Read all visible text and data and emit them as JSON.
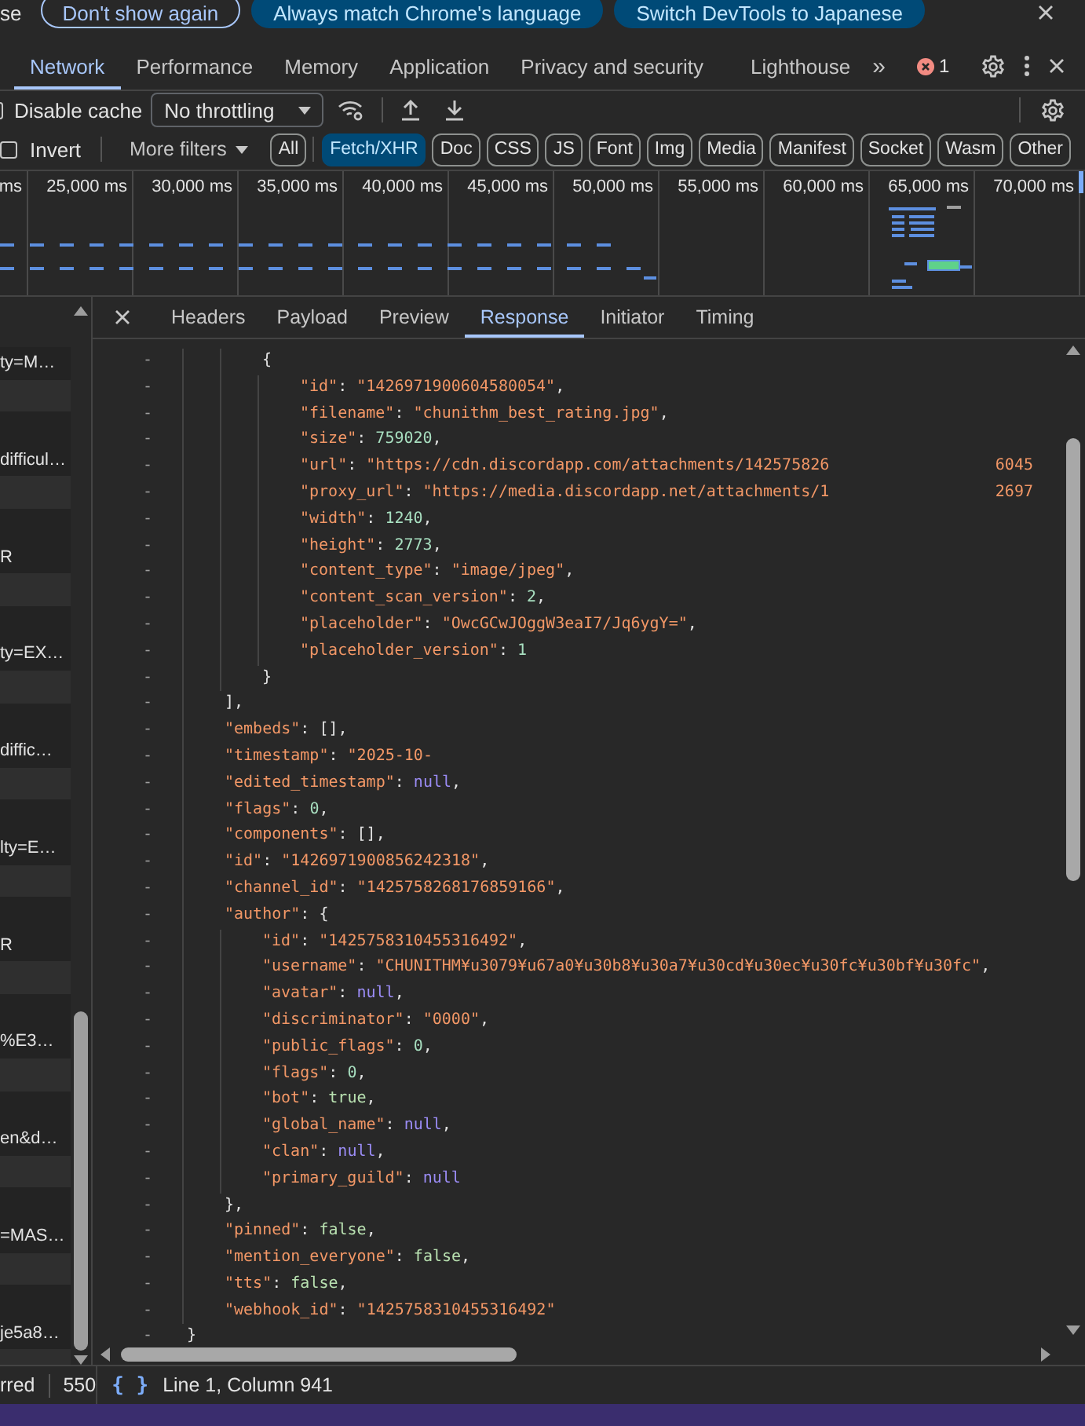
{
  "infobar": {
    "lead_text": "se",
    "buttons": [
      {
        "label": "Don't show again",
        "kind": "outline"
      },
      {
        "label": "Always match Chrome's language",
        "kind": "filled"
      },
      {
        "label": "Switch DevTools to Japanese",
        "kind": "filled"
      }
    ]
  },
  "main_tabs": {
    "items": [
      {
        "label": "Network",
        "selected": true
      },
      {
        "label": "Performance",
        "selected": false
      },
      {
        "label": "Memory",
        "selected": false
      },
      {
        "label": "Application",
        "selected": false
      },
      {
        "label": "Privacy and security",
        "selected": false
      },
      {
        "label": "Lighthouse",
        "selected": false
      }
    ],
    "overflow": "»",
    "error_count": "1"
  },
  "toolbar": {
    "disable_cache": {
      "label": "Disable cache",
      "checked": false
    },
    "throttling": {
      "value": "No throttling"
    }
  },
  "filters": {
    "invert": {
      "label": "Invert",
      "checked": false
    },
    "more_filters": "More filters",
    "chips": [
      {
        "label": "All",
        "selected": false
      },
      {
        "label": "Fetch/XHR",
        "selected": true
      },
      {
        "label": "Doc",
        "selected": false
      },
      {
        "label": "CSS",
        "selected": false
      },
      {
        "label": "JS",
        "selected": false
      },
      {
        "label": "Font",
        "selected": false
      },
      {
        "label": "Img",
        "selected": false
      },
      {
        "label": "Media",
        "selected": false
      },
      {
        "label": "Manifest",
        "selected": false
      },
      {
        "label": "Socket",
        "selected": false
      },
      {
        "label": "Wasm",
        "selected": false
      },
      {
        "label": "Other",
        "selected": false
      }
    ]
  },
  "overview": {
    "ticks": [
      "ms",
      "25,000 ms",
      "30,000 ms",
      "35,000 ms",
      "40,000 ms",
      "45,000 ms",
      "50,000 ms",
      "55,000 ms",
      "60,000 ms",
      "65,000 ms",
      "70,000 ms"
    ]
  },
  "requests": [
    {
      "name": "ty=M…"
    },
    {
      "name": "difficul…"
    },
    {
      "name": "R"
    },
    {
      "name": "ty=EX…"
    },
    {
      "name": "diffic…"
    },
    {
      "name": "lty=E…"
    },
    {
      "name": "R"
    },
    {
      "name": "%E3…"
    },
    {
      "name": "en&d…"
    },
    {
      "name": "=MAS…"
    },
    {
      "name": "je5a8…"
    }
  ],
  "detail_tabs": [
    {
      "label": "Headers",
      "selected": false
    },
    {
      "label": "Payload",
      "selected": false
    },
    {
      "label": "Preview",
      "selected": false
    },
    {
      "label": "Response",
      "selected": true
    },
    {
      "label": "Initiator",
      "selected": false
    },
    {
      "label": "Timing",
      "selected": false
    }
  ],
  "response": {
    "lines": [
      {
        "children": [
          {
            "children": [
              {
                "mark": "-",
                "tokens": [
                  {
                    "kind": "punct",
                    "text": "{"
                  }
                ],
                "children": [
                  {
                    "mark": "-",
                    "tokens": [
                      {
                        "kind": "key",
                        "text": "\"id\""
                      },
                      {
                        "kind": "punct",
                        "text": ": "
                      },
                      {
                        "kind": "string",
                        "text": "\"1426971900604580054\""
                      },
                      {
                        "kind": "punct",
                        "text": ","
                      }
                    ]
                  },
                  {
                    "mark": "-",
                    "tokens": [
                      {
                        "kind": "key",
                        "text": "\"filename\""
                      },
                      {
                        "kind": "punct",
                        "text": ": "
                      },
                      {
                        "kind": "string",
                        "text": "\"chunithm_best_rating.jpg\""
                      },
                      {
                        "kind": "punct",
                        "text": ","
                      }
                    ]
                  },
                  {
                    "mark": "-",
                    "tokens": [
                      {
                        "kind": "key",
                        "text": "\"size\""
                      },
                      {
                        "kind": "punct",
                        "text": ": "
                      },
                      {
                        "kind": "number",
                        "text": "759020"
                      },
                      {
                        "kind": "punct",
                        "text": ","
                      }
                    ]
                  },
                  {
                    "mark": "-",
                    "tokens": [
                      {
                        "kind": "key",
                        "text": "\"url\""
                      },
                      {
                        "kind": "punct",
                        "text": ": "
                      },
                      {
                        "kind": "string",
                        "text": "\"https://cdn.discordapp.com/attachments/142575826"
                      }
                    ],
                    "tail": {
                      "kind": "string",
                      "text": "6045"
                    }
                  },
                  {
                    "mark": "-",
                    "tokens": [
                      {
                        "kind": "key",
                        "text": "\"proxy_url\""
                      },
                      {
                        "kind": "punct",
                        "text": ": "
                      },
                      {
                        "kind": "string",
                        "text": "\"https://media.discordapp.net/attachments/1"
                      }
                    ],
                    "tail": {
                      "kind": "string",
                      "text": "2697"
                    }
                  },
                  {
                    "mark": "-",
                    "tokens": [
                      {
                        "kind": "key",
                        "text": "\"width\""
                      },
                      {
                        "kind": "punct",
                        "text": ": "
                      },
                      {
                        "kind": "number",
                        "text": "1240"
                      },
                      {
                        "kind": "punct",
                        "text": ","
                      }
                    ]
                  },
                  {
                    "mark": "-",
                    "tokens": [
                      {
                        "kind": "key",
                        "text": "\"height\""
                      },
                      {
                        "kind": "punct",
                        "text": ": "
                      },
                      {
                        "kind": "number",
                        "text": "2773"
                      },
                      {
                        "kind": "punct",
                        "text": ","
                      }
                    ]
                  },
                  {
                    "mark": "-",
                    "tokens": [
                      {
                        "kind": "key",
                        "text": "\"content_type\""
                      },
                      {
                        "kind": "punct",
                        "text": ": "
                      },
                      {
                        "kind": "string",
                        "text": "\"image/jpeg\""
                      },
                      {
                        "kind": "punct",
                        "text": ","
                      }
                    ]
                  },
                  {
                    "mark": "-",
                    "tokens": [
                      {
                        "kind": "key",
                        "text": "\"content_scan_version\""
                      },
                      {
                        "kind": "punct",
                        "text": ": "
                      },
                      {
                        "kind": "number",
                        "text": "2"
                      },
                      {
                        "kind": "punct",
                        "text": ","
                      }
                    ]
                  },
                  {
                    "mark": "-",
                    "tokens": [
                      {
                        "kind": "key",
                        "text": "\"placeholder\""
                      },
                      {
                        "kind": "punct",
                        "text": ": "
                      },
                      {
                        "kind": "string",
                        "text": "\"OwcGCwJOggW3eaI7/Jq6ygY=\""
                      },
                      {
                        "kind": "punct",
                        "text": ","
                      }
                    ]
                  },
                  {
                    "mark": "-",
                    "tokens": [
                      {
                        "kind": "key",
                        "text": "\"placeholder_version\""
                      },
                      {
                        "kind": "punct",
                        "text": ": "
                      },
                      {
                        "kind": "number",
                        "text": "1"
                      }
                    ]
                  }
                ]
              },
              {
                "mark": "-",
                "tokens": [
                  {
                    "kind": "punct",
                    "text": "}"
                  }
                ]
              }
            ]
          },
          {
            "mark": "-",
            "tokens": [
              {
                "kind": "punct",
                "text": "],"
              }
            ]
          },
          {
            "mark": "-",
            "tokens": [
              {
                "kind": "key",
                "text": "\"embeds\""
              },
              {
                "kind": "punct",
                "text": ": [],"
              }
            ]
          },
          {
            "mark": "-",
            "tokens": [
              {
                "kind": "key",
                "text": "\"timestamp\""
              },
              {
                "kind": "punct",
                "text": ": "
              },
              {
                "kind": "string",
                "text": "\"2025-10-"
              }
            ]
          },
          {
            "mark": "-",
            "tokens": [
              {
                "kind": "key",
                "text": "\"edited_timestamp\""
              },
              {
                "kind": "punct",
                "text": ": "
              },
              {
                "kind": "null",
                "text": "null"
              },
              {
                "kind": "punct",
                "text": ","
              }
            ]
          },
          {
            "mark": "-",
            "tokens": [
              {
                "kind": "key",
                "text": "\"flags\""
              },
              {
                "kind": "punct",
                "text": ": "
              },
              {
                "kind": "number",
                "text": "0"
              },
              {
                "kind": "punct",
                "text": ","
              }
            ]
          },
          {
            "mark": "-",
            "tokens": [
              {
                "kind": "key",
                "text": "\"components\""
              },
              {
                "kind": "punct",
                "text": ": [],"
              }
            ]
          },
          {
            "mark": "-",
            "tokens": [
              {
                "kind": "key",
                "text": "\"id\""
              },
              {
                "kind": "punct",
                "text": ": "
              },
              {
                "kind": "string",
                "text": "\"1426971900856242318\""
              },
              {
                "kind": "punct",
                "text": ","
              }
            ]
          },
          {
            "mark": "-",
            "tokens": [
              {
                "kind": "key",
                "text": "\"channel_id\""
              },
              {
                "kind": "punct",
                "text": ": "
              },
              {
                "kind": "string",
                "text": "\"1425758268176859166\""
              },
              {
                "kind": "punct",
                "text": ","
              }
            ]
          },
          {
            "mark": "-",
            "tokens": [
              {
                "kind": "key",
                "text": "\"author\""
              },
              {
                "kind": "punct",
                "text": ": {"
              }
            ],
            "children": [
              {
                "mark": "-",
                "tokens": [
                  {
                    "kind": "key",
                    "text": "\"id\""
                  },
                  {
                    "kind": "punct",
                    "text": ": "
                  },
                  {
                    "kind": "string",
                    "text": "\"1425758310455316492\""
                  },
                  {
                    "kind": "punct",
                    "text": ","
                  }
                ]
              },
              {
                "mark": "-",
                "tokens": [
                  {
                    "kind": "key",
                    "text": "\"username\""
                  },
                  {
                    "kind": "punct",
                    "text": ": "
                  },
                  {
                    "kind": "string",
                    "text": "\"CHUNITHM¥u3079¥u67a0¥u30b8¥u30a7¥u30cd¥u30ec¥u30fc¥u30bf¥u30fc\""
                  },
                  {
                    "kind": "punct",
                    "text": ","
                  }
                ]
              },
              {
                "mark": "-",
                "tokens": [
                  {
                    "kind": "key",
                    "text": "\"avatar\""
                  },
                  {
                    "kind": "punct",
                    "text": ": "
                  },
                  {
                    "kind": "null",
                    "text": "null"
                  },
                  {
                    "kind": "punct",
                    "text": ","
                  }
                ]
              },
              {
                "mark": "-",
                "tokens": [
                  {
                    "kind": "key",
                    "text": "\"discriminator\""
                  },
                  {
                    "kind": "punct",
                    "text": ": "
                  },
                  {
                    "kind": "string",
                    "text": "\"0000\""
                  },
                  {
                    "kind": "punct",
                    "text": ","
                  }
                ]
              },
              {
                "mark": "-",
                "tokens": [
                  {
                    "kind": "key",
                    "text": "\"public_flags\""
                  },
                  {
                    "kind": "punct",
                    "text": ": "
                  },
                  {
                    "kind": "number",
                    "text": "0"
                  },
                  {
                    "kind": "punct",
                    "text": ","
                  }
                ]
              },
              {
                "mark": "-",
                "tokens": [
                  {
                    "kind": "key",
                    "text": "\"flags\""
                  },
                  {
                    "kind": "punct",
                    "text": ": "
                  },
                  {
                    "kind": "number",
                    "text": "0"
                  },
                  {
                    "kind": "punct",
                    "text": ","
                  }
                ]
              },
              {
                "mark": "-",
                "tokens": [
                  {
                    "kind": "key",
                    "text": "\"bot\""
                  },
                  {
                    "kind": "punct",
                    "text": ": "
                  },
                  {
                    "kind": "boolean",
                    "text": "true"
                  },
                  {
                    "kind": "punct",
                    "text": ","
                  }
                ]
              },
              {
                "mark": "-",
                "tokens": [
                  {
                    "kind": "key",
                    "text": "\"global_name\""
                  },
                  {
                    "kind": "punct",
                    "text": ": "
                  },
                  {
                    "kind": "null",
                    "text": "null"
                  },
                  {
                    "kind": "punct",
                    "text": ","
                  }
                ]
              },
              {
                "mark": "-",
                "tokens": [
                  {
                    "kind": "key",
                    "text": "\"clan\""
                  },
                  {
                    "kind": "punct",
                    "text": ": "
                  },
                  {
                    "kind": "null",
                    "text": "null"
                  },
                  {
                    "kind": "punct",
                    "text": ","
                  }
                ]
              },
              {
                "mark": "-",
                "tokens": [
                  {
                    "kind": "key",
                    "text": "\"primary_guild\""
                  },
                  {
                    "kind": "punct",
                    "text": ": "
                  },
                  {
                    "kind": "null",
                    "text": "null"
                  }
                ]
              }
            ]
          },
          {
            "mark": "-",
            "tokens": [
              {
                "kind": "punct",
                "text": "},"
              }
            ]
          },
          {
            "mark": "-",
            "tokens": [
              {
                "kind": "key",
                "text": "\"pinned\""
              },
              {
                "kind": "punct",
                "text": ": "
              },
              {
                "kind": "boolean",
                "text": "false"
              },
              {
                "kind": "punct",
                "text": ","
              }
            ]
          },
          {
            "mark": "-",
            "tokens": [
              {
                "kind": "key",
                "text": "\"mention_everyone\""
              },
              {
                "kind": "punct",
                "text": ": "
              },
              {
                "kind": "boolean",
                "text": "false"
              },
              {
                "kind": "punct",
                "text": ","
              }
            ]
          },
          {
            "mark": "-",
            "tokens": [
              {
                "kind": "key",
                "text": "\"tts\""
              },
              {
                "kind": "punct",
                "text": ": "
              },
              {
                "kind": "boolean",
                "text": "false"
              },
              {
                "kind": "punct",
                "text": ","
              }
            ]
          },
          {
            "mark": "-",
            "tokens": [
              {
                "kind": "key",
                "text": "\"webhook_id\""
              },
              {
                "kind": "punct",
                "text": ": "
              },
              {
                "kind": "string",
                "text": "\"1425758310455316492\""
              }
            ]
          }
        ]
      },
      {
        "mark": "-",
        "tokens": [
          {
            "kind": "punct",
            "text": "}"
          }
        ]
      }
    ]
  },
  "status_bar": {
    "transferred": "rred",
    "size": "550",
    "pretty_print": "{ }",
    "position": "Line 1, Column 941"
  }
}
